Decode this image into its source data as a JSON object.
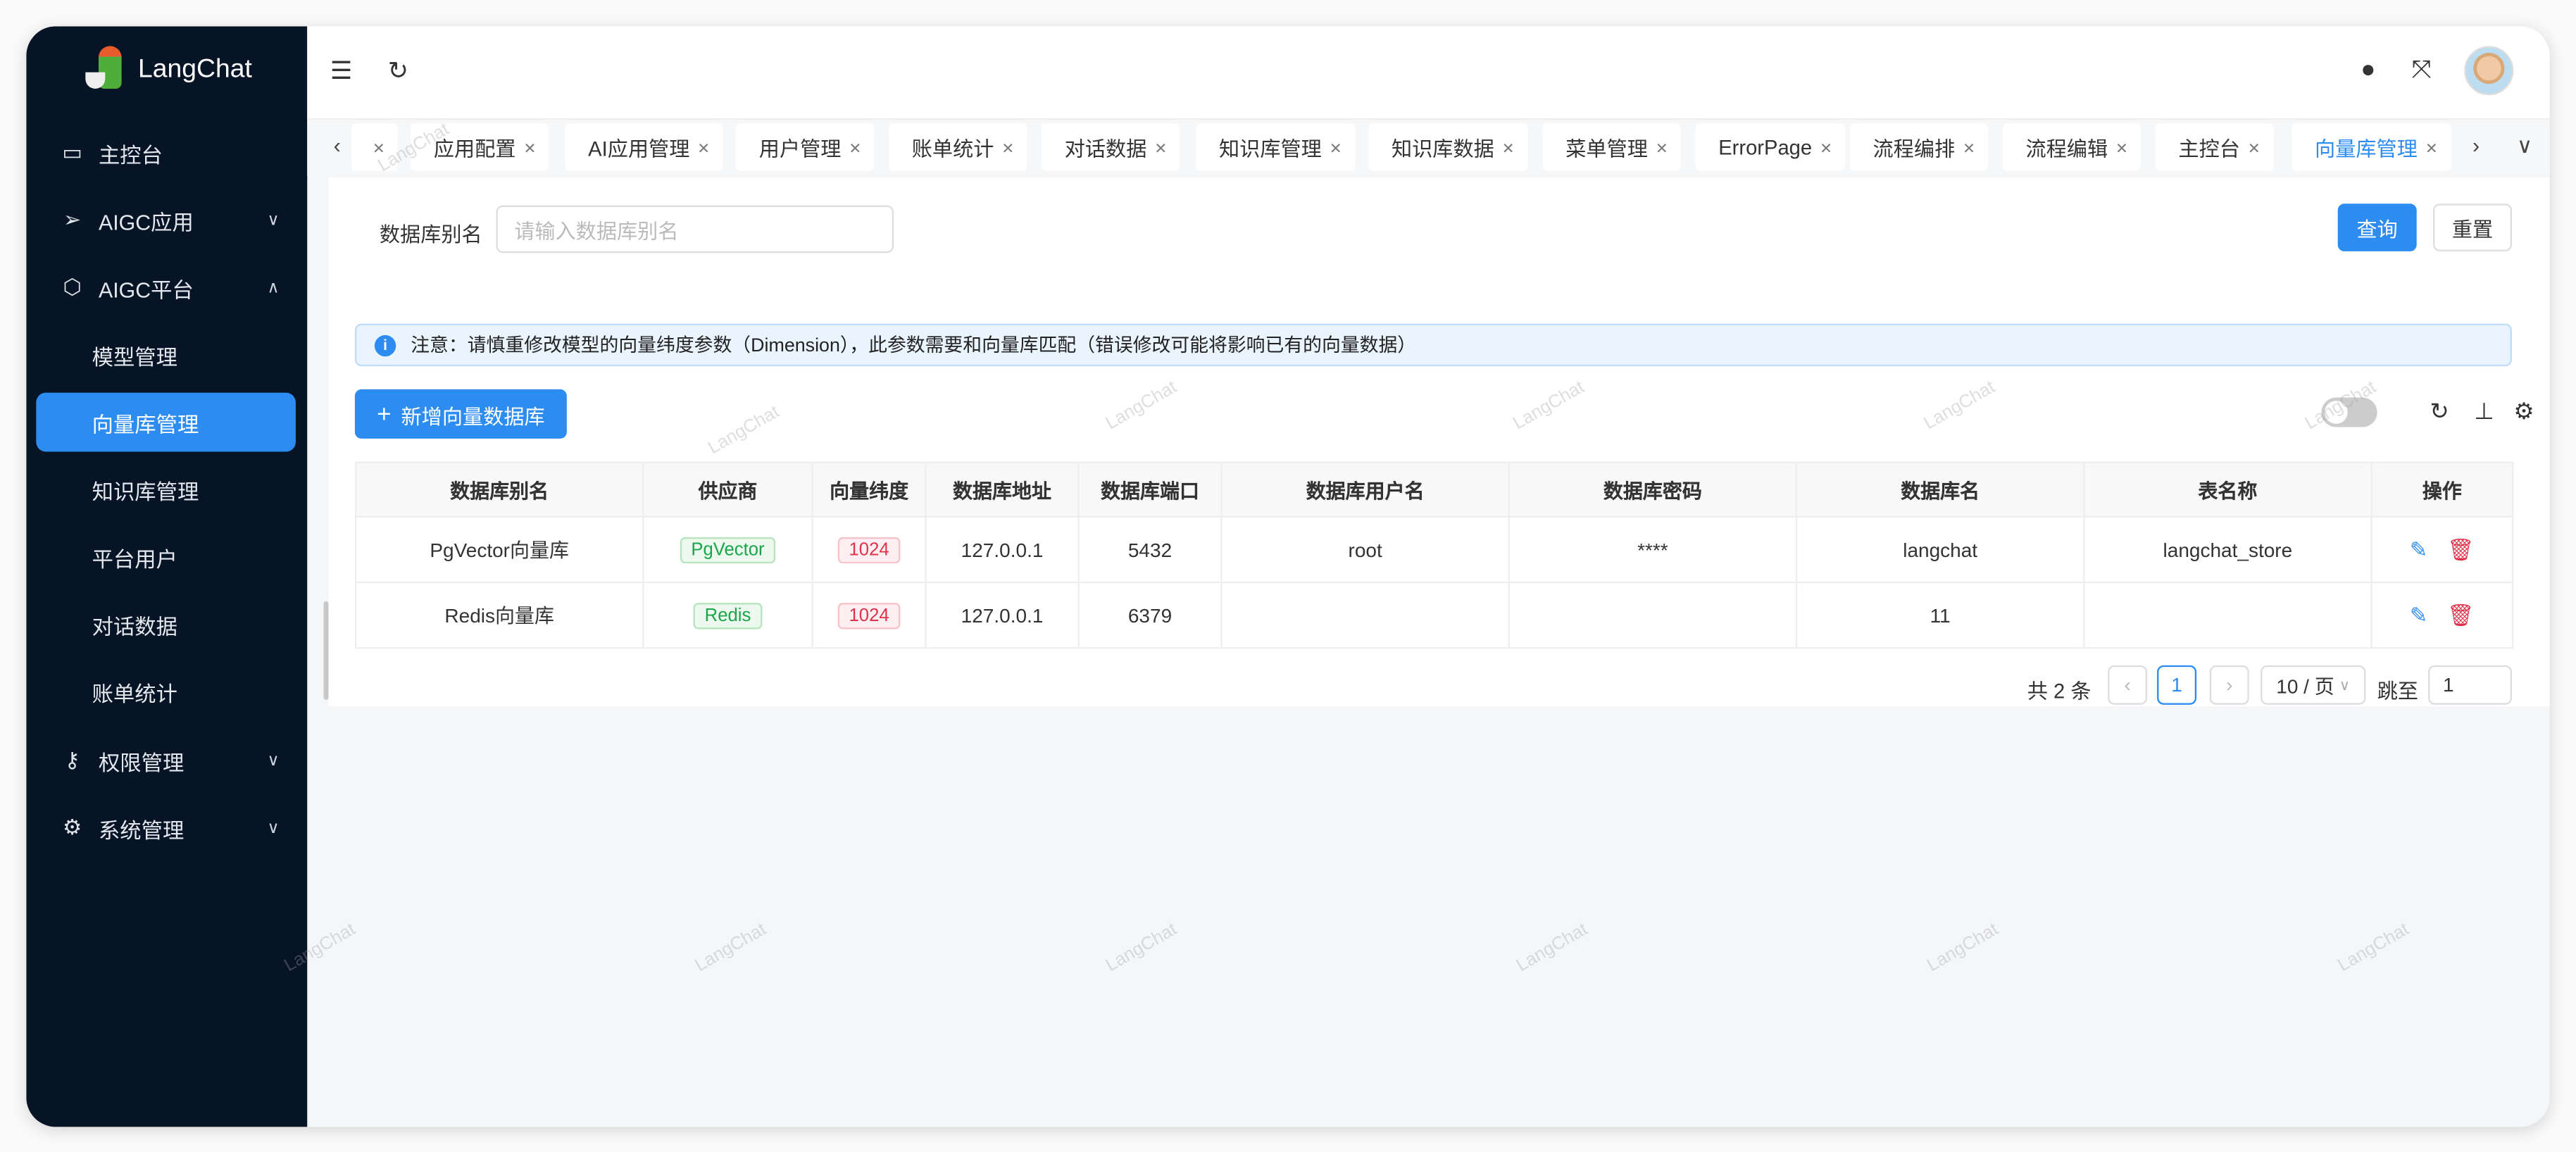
{
  "app": {
    "title": "LangChat"
  },
  "sidebar": {
    "items": [
      {
        "label": "主控台",
        "icon": "inbox-icon"
      },
      {
        "label": "AIGC应用",
        "icon": "send-icon"
      },
      {
        "label": "AIGC平台",
        "icon": "cube-icon"
      },
      {
        "label": "模型管理"
      },
      {
        "label": "向量库管理",
        "active": true
      },
      {
        "label": "知识库管理"
      },
      {
        "label": "平台用户"
      },
      {
        "label": "对话数据"
      },
      {
        "label": "账单统计"
      },
      {
        "label": "权限管理",
        "icon": "key-icon"
      },
      {
        "label": "系统管理",
        "icon": "gear-icon"
      }
    ]
  },
  "tabs": [
    {
      "label": "应用配置"
    },
    {
      "label": "AI应用管理"
    },
    {
      "label": "用户管理"
    },
    {
      "label": "账单统计"
    },
    {
      "label": "对话数据"
    },
    {
      "label": "知识库管理"
    },
    {
      "label": "知识库数据"
    },
    {
      "label": "菜单管理"
    },
    {
      "label": "ErrorPage"
    },
    {
      "label": "流程编排"
    },
    {
      "label": "流程编辑"
    },
    {
      "label": "主控台"
    },
    {
      "label": "向量库管理",
      "active": true
    }
  ],
  "search": {
    "label": "数据库别名",
    "placeholder": "请输入数据库别名",
    "query": "查询",
    "reset": "重置"
  },
  "alert": "注意：请慎重修改模型的向量纬度参数（Dimension），此参数需要和向量库匹配（错误修改可能将影响已有的向量数据）",
  "add_button": "新增向量数据库",
  "table": {
    "headers": [
      "数据库别名",
      "供应商",
      "向量纬度",
      "数据库地址",
      "数据库端口",
      "数据库用户名",
      "数据库密码",
      "数据库名",
      "表名称",
      "操作"
    ],
    "rows": [
      {
        "name": "PgVector向量库",
        "provider": "PgVector",
        "dim": "1024",
        "host": "127.0.0.1",
        "port": "5432",
        "user": "root",
        "pwd": "****",
        "db": "langchat",
        "table": "langchat_store"
      },
      {
        "name": "Redis向量库",
        "provider": "Redis",
        "dim": "1024",
        "host": "127.0.0.1",
        "port": "6379",
        "user": "",
        "pwd": "",
        "db": "11",
        "table": ""
      }
    ]
  },
  "pagination": {
    "total": "共 2 条",
    "page": "1",
    "page_size": "10 / 页",
    "jump_label": "跳至",
    "jump_value": "1"
  },
  "watermark": "LangChat",
  "colors": {
    "primary": "#2d8cf0",
    "sidebar": "#061426"
  }
}
